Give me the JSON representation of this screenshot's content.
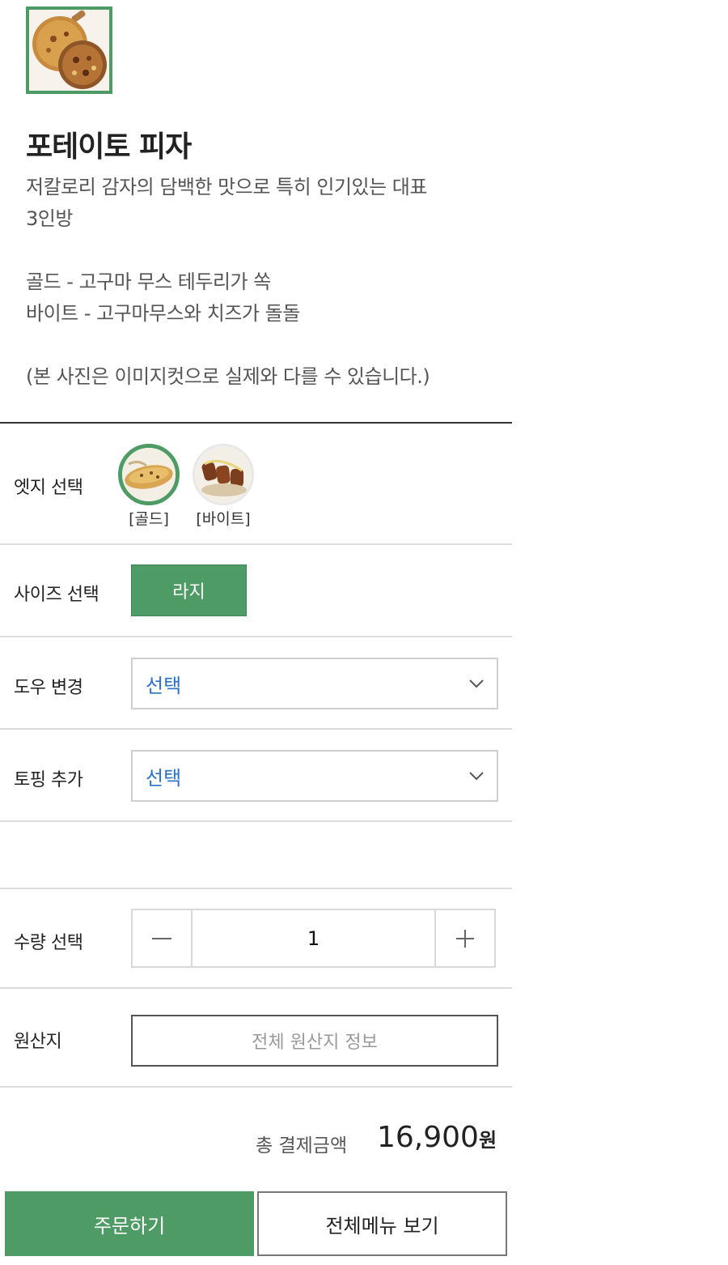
{
  "product": {
    "image_icon": "potato-pizza-photo",
    "title": "포테이토 피자",
    "description_lines": [
      "저칼로리 감자의 담백한 맛으로 특히 인기있는 대표",
      "3인방",
      "",
      "골드 - 고구마 무스 테두리가 쏙",
      "바이트 - 고구마무스와 치즈가 돌돌",
      "",
      "(본 사진은 이미지컷으로 실제와 다를 수 있습니다.)"
    ]
  },
  "edge": {
    "label": "엣지 선택",
    "options": [
      {
        "caption": "[골드]",
        "icon": "gold-edge-photo",
        "selected": true
      },
      {
        "caption": "[바이트]",
        "icon": "bite-edge-photo",
        "selected": false
      }
    ]
  },
  "size": {
    "label": "사이즈 선택",
    "option": "라지"
  },
  "dough": {
    "label": "도우 변경",
    "value": "선택"
  },
  "topping": {
    "label": "토핑 추가",
    "value": "선택"
  },
  "quantity": {
    "label": "수량 선택",
    "value": "1"
  },
  "origin": {
    "label": "원산지",
    "button": "전체 원산지 정보"
  },
  "total": {
    "label": "총 결제금액",
    "amount": "16,900",
    "unit": "원"
  },
  "actions": {
    "order": "주문하기",
    "all_menu": "전체메뉴 보기"
  },
  "colors": {
    "accent": "#4f9b66",
    "select_text": "#2b71c9"
  }
}
